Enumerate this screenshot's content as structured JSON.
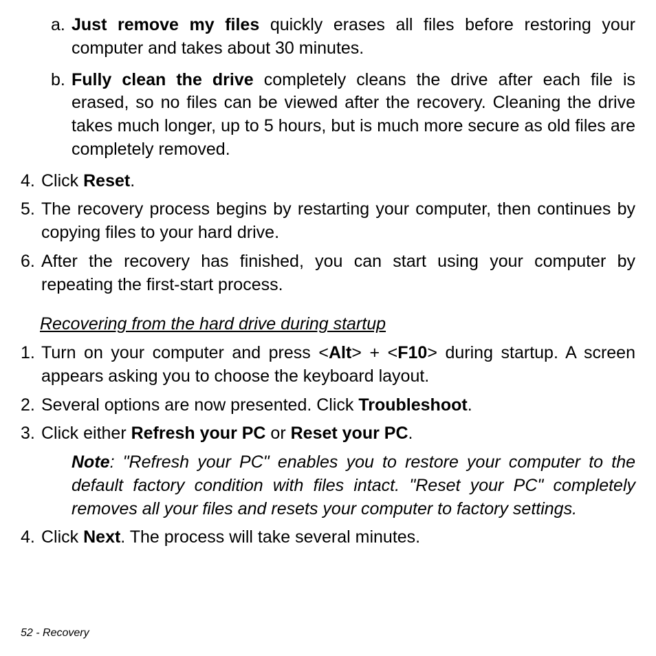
{
  "sublist": {
    "a": {
      "marker": "a.",
      "bold": "Just remove my files",
      "rest": " quickly erases all files before restoring your computer and takes about 30 minutes."
    },
    "b": {
      "marker": "b.",
      "bold": "Fully clean the drive",
      "rest": " completely cleans the drive after each file is erased, so no files can be viewed after the recovery. Cleaning the drive takes much longer, up to 5 hours, but is much more secure as old files are completely removed."
    }
  },
  "steps1": {
    "s4": {
      "marker": "4.",
      "pre": "Click ",
      "bold": "Reset",
      "post": "."
    },
    "s5": {
      "marker": "5.",
      "text": "The recovery process begins by restarting your computer, then continues by copying files to your hard drive."
    },
    "s6": {
      "marker": "6.",
      "text": "After the recovery has finished, you can start using your computer by repeating the first-start process."
    }
  },
  "heading": "Recovering from the hard drive during startup",
  "steps2": {
    "s1": {
      "marker": "1.",
      "pre": "Turn on your computer and press <",
      "bold1": "Alt",
      "mid": "> + <",
      "bold2": "F10",
      "post": "> during startup. A screen appears asking you to choose the keyboard layout."
    },
    "s2": {
      "marker": "2.",
      "pre": "Several options are now presented. Click ",
      "bold": "Troubleshoot",
      "post": "."
    },
    "s3": {
      "marker": "3.",
      "pre": "Click either ",
      "bold1": "Refresh your PC",
      "mid": " or ",
      "bold2": "Reset your PC",
      "post": "."
    },
    "s4": {
      "marker": "4.",
      "pre": "Click ",
      "bold": "Next",
      "post": ". The process will take several minutes."
    }
  },
  "note": {
    "label": "Note",
    "text": ": \"Refresh your PC\" enables you to restore your computer to the default factory condition with files intact. \"Reset your PC\" completely removes all your files and resets your computer to factory settings."
  },
  "footer": "52 - Recovery"
}
